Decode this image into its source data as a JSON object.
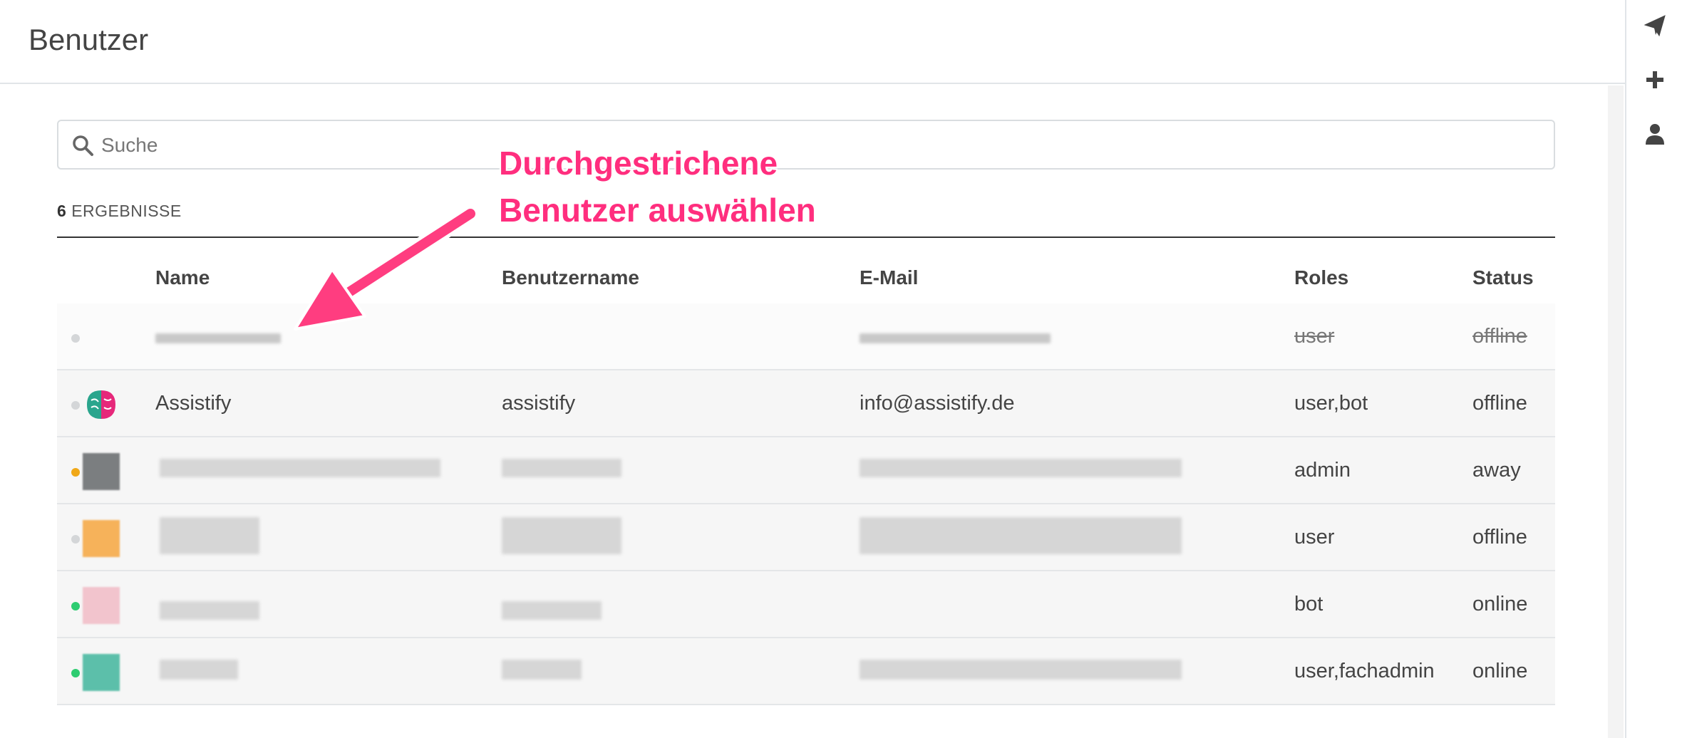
{
  "page": {
    "title": "Benutzer"
  },
  "search": {
    "placeholder": "Suche",
    "value": ""
  },
  "results": {
    "count": "6",
    "label": "ERGEBNISSE"
  },
  "table": {
    "headers": {
      "name": "Name",
      "username": "Benutzername",
      "email": "E-Mail",
      "roles": "Roles",
      "status": "Status"
    },
    "rows": [
      {
        "name": "",
        "username": "",
        "email": "",
        "roles": "user",
        "status": "offline",
        "struck": true,
        "presence": "offline"
      },
      {
        "name": "Assistify",
        "username": "assistify",
        "email": "info@assistify.de",
        "roles": "user,bot",
        "status": "offline",
        "struck": false,
        "presence": "offline"
      },
      {
        "name": "",
        "username": "",
        "email": "",
        "roles": "admin",
        "status": "away",
        "struck": false,
        "presence": "away"
      },
      {
        "name": "",
        "username": "",
        "email": "",
        "roles": "user",
        "status": "offline",
        "struck": false,
        "presence": "offline"
      },
      {
        "name": "",
        "username": "",
        "email": "",
        "roles": "bot",
        "status": "online",
        "struck": false,
        "presence": "online"
      },
      {
        "name": "",
        "username": "",
        "email": "",
        "roles": "user,fachadmin",
        "status": "online",
        "struck": false,
        "presence": "online"
      }
    ]
  },
  "annotation": {
    "line1": "Durchgestrichene",
    "line2": "Benutzer auswählen"
  },
  "rail": {
    "icons": [
      "send-icon",
      "plus-icon",
      "user-icon"
    ]
  },
  "colors": {
    "annotation": "#ff2e7e",
    "online": "#2de0a5",
    "away": "#ffd21f",
    "offline": "#cbced1"
  }
}
